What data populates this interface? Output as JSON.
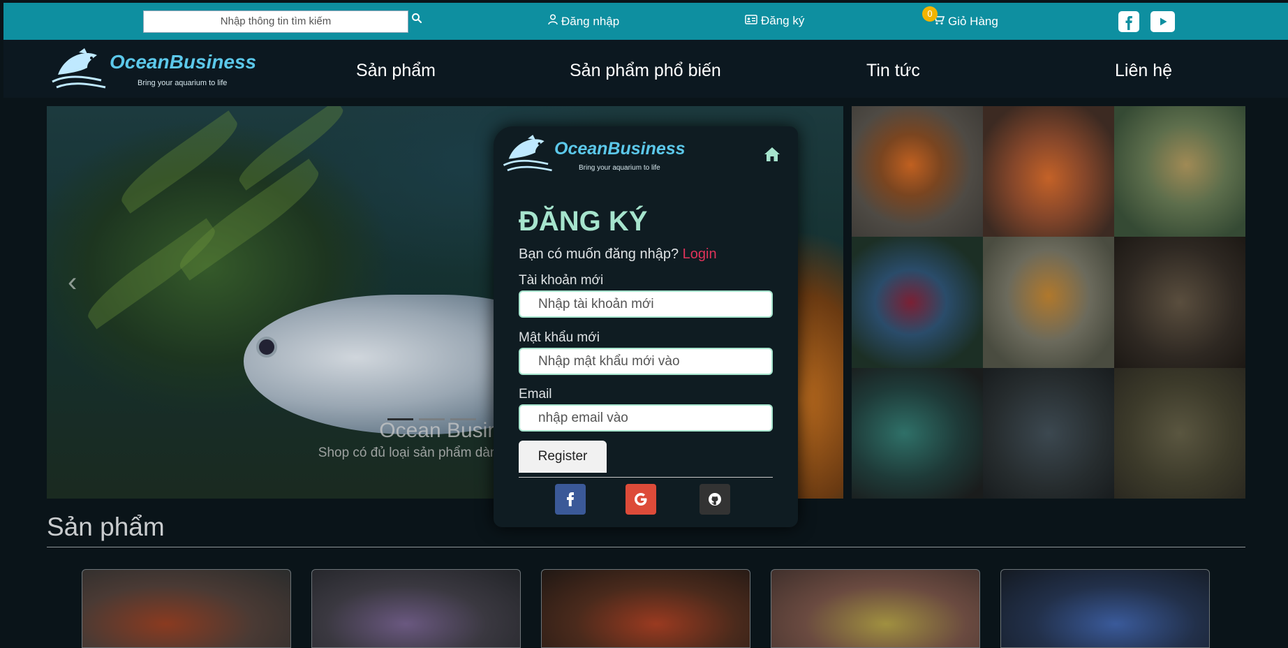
{
  "topbar": {
    "search_placeholder": "Nhập thông tin tìm kiếm",
    "login_label": "Đăng nhập",
    "register_label": "Đăng ký",
    "cart_label": "Giỏ Hàng",
    "cart_count": "0",
    "facebook_icon": "facebook-icon",
    "youtube_icon": "youtube-icon"
  },
  "brand": {
    "name": "OceanBusiness",
    "tagline": "Bring your aquarium to life"
  },
  "nav": {
    "items": [
      "Sản phẩm",
      "Sản phẩm phổ biến",
      "Tin tức",
      "Liên hệ"
    ]
  },
  "hero": {
    "caption_title": "Ocean Busine",
    "caption_text": "Shop có đủ loại sản phẩm dành cho những"
  },
  "products_section": {
    "title": "Sản phẩm"
  },
  "register_modal": {
    "title": "ĐĂNG KÝ",
    "login_prompt": "Bạn có muốn đăng nhập?",
    "login_link": "Login",
    "username_label": "Tài khoản mới",
    "username_placeholder": "Nhập tài khoản mới",
    "password_label": "Mật khẩu mới",
    "password_placeholder": "Nhập mật khẩu mới vào",
    "email_label": "Email",
    "email_placeholder": "nhập email vào",
    "register_button": "Register",
    "social": [
      "facebook",
      "google",
      "github"
    ]
  },
  "colors": {
    "topbar": "#0e8fa0",
    "navbar": "#0c1820",
    "accent_mint": "#a6e4cd",
    "login_link": "#e0335a",
    "facebook": "#3b5998",
    "google": "#dd4b39",
    "github": "#333333"
  }
}
